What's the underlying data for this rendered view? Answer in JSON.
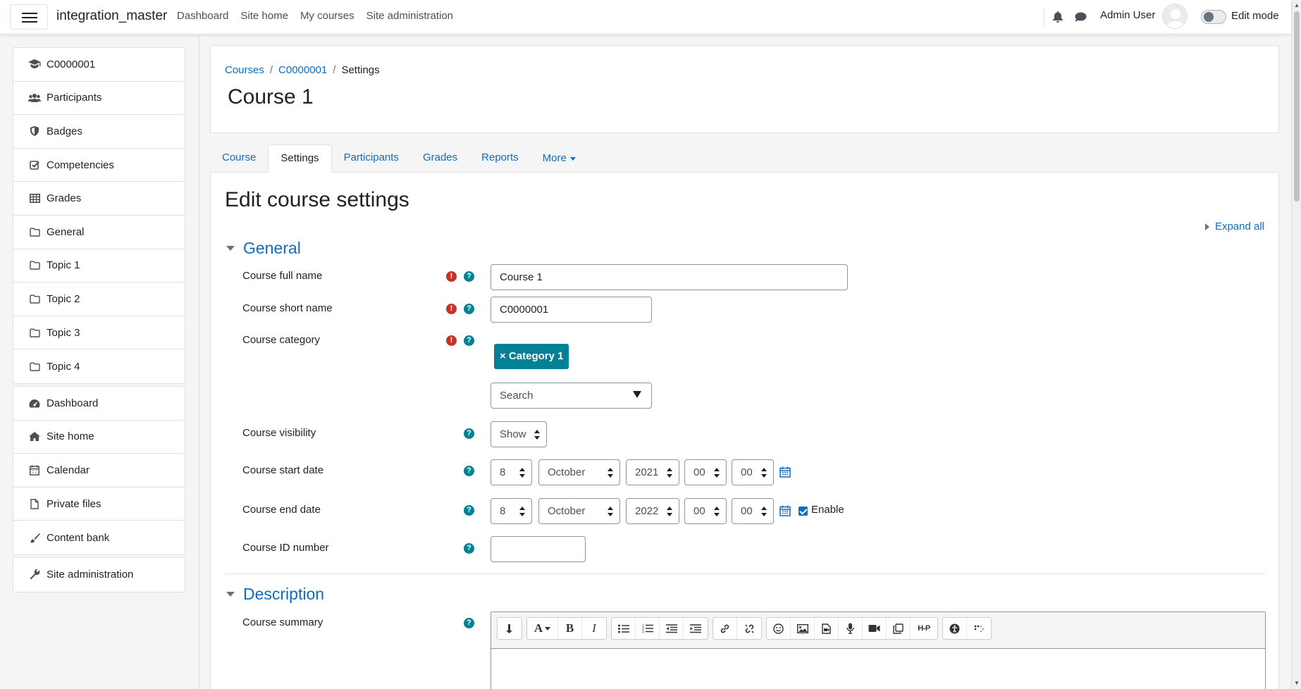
{
  "navbar": {
    "brand": "integration_master",
    "links": [
      "Dashboard",
      "Site home",
      "My courses",
      "Site administration"
    ],
    "username": "Admin User",
    "edit_mode_label": "Edit mode",
    "edit_mode_on": false
  },
  "sidebar": {
    "course_items": [
      {
        "label": "C0000001",
        "icon": "graduation-cap-icon"
      },
      {
        "label": "Participants",
        "icon": "users-icon"
      },
      {
        "label": "Badges",
        "icon": "shield-icon"
      },
      {
        "label": "Competencies",
        "icon": "check-square-icon"
      },
      {
        "label": "Grades",
        "icon": "table-icon"
      },
      {
        "label": "General",
        "icon": "folder-icon"
      },
      {
        "label": "Topic 1",
        "icon": "folder-icon"
      },
      {
        "label": "Topic 2",
        "icon": "folder-icon"
      },
      {
        "label": "Topic 3",
        "icon": "folder-icon"
      },
      {
        "label": "Topic 4",
        "icon": "folder-icon"
      }
    ],
    "site_items": [
      {
        "label": "Dashboard",
        "icon": "dashboard-icon"
      },
      {
        "label": "Site home",
        "icon": "home-icon"
      },
      {
        "label": "Calendar",
        "icon": "calendar-icon"
      },
      {
        "label": "Private files",
        "icon": "file-icon"
      },
      {
        "label": "Content bank",
        "icon": "paintbrush-icon"
      }
    ],
    "admin_items": [
      {
        "label": "Site administration",
        "icon": "wrench-icon"
      }
    ]
  },
  "header": {
    "breadcrumb": [
      "Courses",
      "C0000001",
      "Settings"
    ],
    "title": "Course 1"
  },
  "tabs": [
    "Course",
    "Settings",
    "Participants",
    "Grades",
    "Reports",
    "More"
  ],
  "active_tab": "Settings",
  "form": {
    "heading": "Edit course settings",
    "expand_all": "Expand all",
    "general_section": "General",
    "description_section": "Description",
    "full_name_label": "Course full name",
    "full_name_value": "Course 1",
    "short_name_label": "Course short name",
    "short_name_value": "C0000001",
    "category_label": "Course category",
    "category_value": "× Category 1",
    "category_search_placeholder": "Search",
    "visibility_label": "Course visibility",
    "visibility_value": "Show",
    "start_date_label": "Course start date",
    "start_date": {
      "day": "8",
      "month": "October",
      "year": "2021",
      "hour": "00",
      "minute": "00"
    },
    "end_date_label": "Course end date",
    "end_date": {
      "day": "8",
      "month": "October",
      "year": "2022",
      "hour": "00",
      "minute": "00"
    },
    "end_date_enable_label": "Enable",
    "end_date_enabled": true,
    "id_number_label": "Course ID number",
    "id_number_value": "",
    "summary_label": "Course summary"
  },
  "editor_toolbar": [
    [
      "collapse-icon"
    ],
    [
      "font-style-icon",
      "bold-icon",
      "italic-icon"
    ],
    [
      "unordered-list-icon",
      "ordered-list-icon",
      "outdent-icon",
      "indent-icon"
    ],
    [
      "link-icon",
      "unlink-icon"
    ],
    [
      "emoji-icon",
      "image-icon",
      "media-icon",
      "record-audio-icon",
      "record-video-icon",
      "manage-files-icon",
      "h5p-icon"
    ],
    [
      "accessibility-checker-icon",
      "screenreader-helper-icon"
    ]
  ],
  "colors": {
    "link": "#0f6cbf",
    "teal": "#008196",
    "required": "#ca3120"
  }
}
